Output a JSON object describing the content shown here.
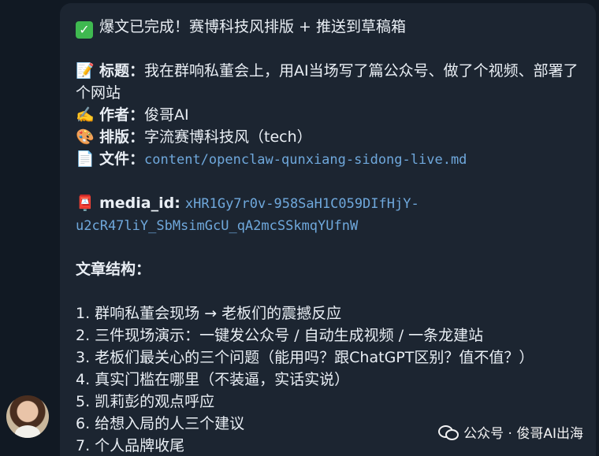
{
  "message": {
    "status_emoji": "✅",
    "header": "爆文已完成！赛博科技风排版 + 推送到草稿箱",
    "title_emoji": "📝",
    "title_label": "标题：",
    "title_value": "我在群响私董会上，用AI当场写了篇公众号、做了个视频、部署了个网站",
    "author_emoji": "✍️",
    "author_label": "作者：",
    "author_value": "俊哥AI",
    "layout_emoji": "🎨",
    "layout_label": "排版：",
    "layout_value": "字流赛博科技风（tech）",
    "file_emoji": "📄",
    "file_label": "文件：",
    "file_value": "content/openclaw-qunxiang-sidong-live.md",
    "media_emoji": "📮",
    "media_label": "media_id:",
    "media_value_line1": "xHR1Gy7r0v-958SaH1C059DIfHjY-",
    "media_value_line2": "u2cR47liY_SbMsimGcU_qA2mcSSkmqYUfnW",
    "structure_heading": "文章结构：",
    "structure_items": [
      "1. 群响私董会现场 → 老板们的震撼反应",
      "2. 三件现场演示：一键发公众号 / 自动生成视频 / 一条龙建站",
      "3. 老板们最关心的三个问题（能用吗？跟ChatGPT区别？值不值？）",
      "4. 真实门槛在哪里（不装逼，实话实说）",
      "5. 凯莉彭的观点呼应",
      "6. 给想入局的人三个建议",
      "7. 个人品牌收尾"
    ]
  },
  "watermark": {
    "icon": "wechat-icon",
    "text": "公众号 · 俊哥AI出海"
  },
  "colors": {
    "background": "#111923",
    "bubble": "#1c2531",
    "text": "#e9eef4",
    "mono_text": "#6fa8dc",
    "check": "#3fb950"
  }
}
